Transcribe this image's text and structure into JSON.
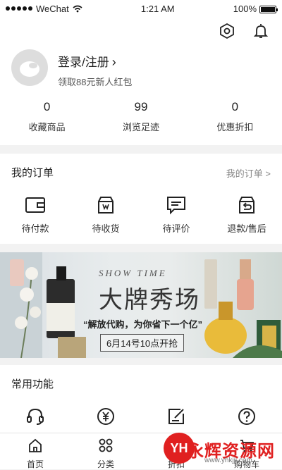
{
  "status_bar": {
    "carrier": "WeChat",
    "time": "1:21 AM",
    "battery": "100%"
  },
  "profile": {
    "login_label": "登录/注册",
    "promo": "领取88元新人红包",
    "stats": [
      {
        "num": "0",
        "label": "收藏商品"
      },
      {
        "num": "99",
        "label": "浏览足迹"
      },
      {
        "num": "0",
        "label": "优惠折扣"
      }
    ]
  },
  "orders": {
    "title": "我的订单",
    "more": "我的订单 >",
    "items": [
      {
        "label": "待付款",
        "icon": "wallet-icon"
      },
      {
        "label": "待收货",
        "icon": "box-icon"
      },
      {
        "label": "待评价",
        "icon": "comment-icon"
      },
      {
        "label": "退款/售后",
        "icon": "refund-icon"
      }
    ]
  },
  "banner": {
    "show_time": "SHOW TIME",
    "headline": "大牌秀场",
    "slogan": "“解放代购，为你省下一个亿”",
    "date": "6月14号10点开抢"
  },
  "common": {
    "title": "常用功能",
    "items": [
      {
        "icon": "headset-icon"
      },
      {
        "icon": "yen-icon"
      },
      {
        "icon": "edit-icon"
      },
      {
        "icon": "help-icon"
      }
    ]
  },
  "tabbar": {
    "items": [
      {
        "label": "首页",
        "icon": "home-icon"
      },
      {
        "label": "分类",
        "icon": "grid-icon"
      },
      {
        "label": "折扣",
        "icon": "discount-icon"
      },
      {
        "label": "购物车",
        "icon": "cart-icon"
      }
    ]
  },
  "watermark": {
    "logo": "YH",
    "text": "永辉资源网",
    "url": "www.yhkjjj.com"
  }
}
